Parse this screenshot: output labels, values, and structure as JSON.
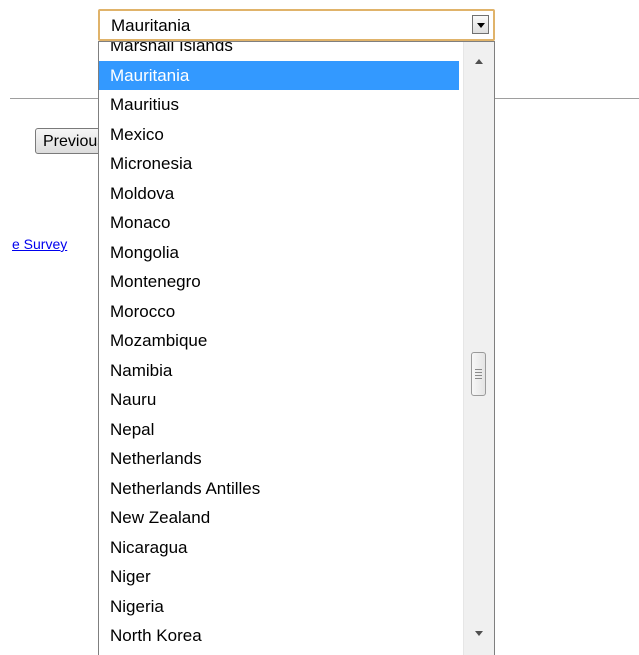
{
  "background": {
    "previous_button_label": "Previous",
    "survey_link_text": "e Survey"
  },
  "select": {
    "value": "Mauritania"
  },
  "dropdown": {
    "selected_index": 1,
    "selected_color": "#3399ff",
    "options": [
      "Marshall Islands",
      "Mauritania",
      "Mauritius",
      "Mexico",
      "Micronesia",
      "Moldova",
      "Monaco",
      "Mongolia",
      "Montenegro",
      "Morocco",
      "Mozambique",
      "Namibia",
      "Nauru",
      "Nepal",
      "Netherlands",
      "Netherlands Antilles",
      "New Zealand",
      "Nicaragua",
      "Niger",
      "Nigeria",
      "North Korea"
    ]
  },
  "icons": {
    "select_arrow": "chevron-down-icon",
    "scroll_up": "scroll-up-arrow-icon",
    "scroll_down": "scroll-down-arrow-icon"
  }
}
